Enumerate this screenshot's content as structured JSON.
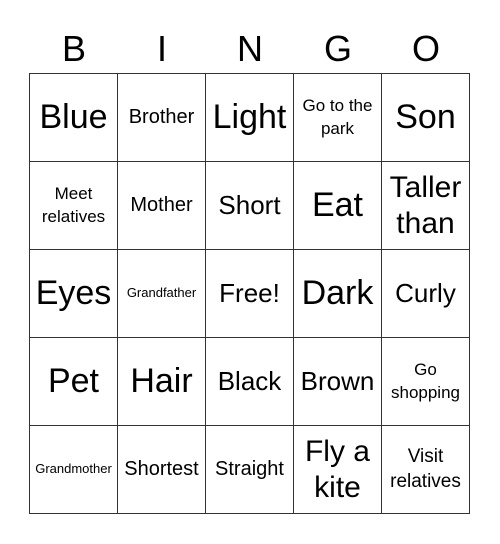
{
  "header": [
    "B",
    "I",
    "N",
    "G",
    "O"
  ],
  "cells": [
    {
      "text": "Blue",
      "size": "xl"
    },
    {
      "text": "Brother",
      "size": "sm"
    },
    {
      "text": "Light",
      "size": "xl"
    },
    {
      "text": "Go to the park",
      "size": "xs"
    },
    {
      "text": "Son",
      "size": "xl"
    },
    {
      "text": "Meet relatives",
      "size": "xs"
    },
    {
      "text": "Mother",
      "size": "sm"
    },
    {
      "text": "Short",
      "size": "md"
    },
    {
      "text": "Eat",
      "size": "xl"
    },
    {
      "text": "Taller than",
      "size": "lg"
    },
    {
      "text": "Eyes",
      "size": "xl"
    },
    {
      "text": "Grandfather",
      "size": "xxs"
    },
    {
      "text": "Free!",
      "size": "md"
    },
    {
      "text": "Dark",
      "size": "xl"
    },
    {
      "text": "Curly",
      "size": "md"
    },
    {
      "text": "Pet",
      "size": "xl"
    },
    {
      "text": "Hair",
      "size": "xl"
    },
    {
      "text": "Black",
      "size": "md"
    },
    {
      "text": "Brown",
      "size": "md"
    },
    {
      "text": "Go shopping",
      "size": "xs"
    },
    {
      "text": "Grandmother",
      "size": "xxs"
    },
    {
      "text": "Shortest",
      "size": "sm"
    },
    {
      "text": "Straight",
      "size": "sm"
    },
    {
      "text": "Fly a kite",
      "size": "lg"
    },
    {
      "text": "Visit relatives",
      "size": "ms"
    }
  ]
}
